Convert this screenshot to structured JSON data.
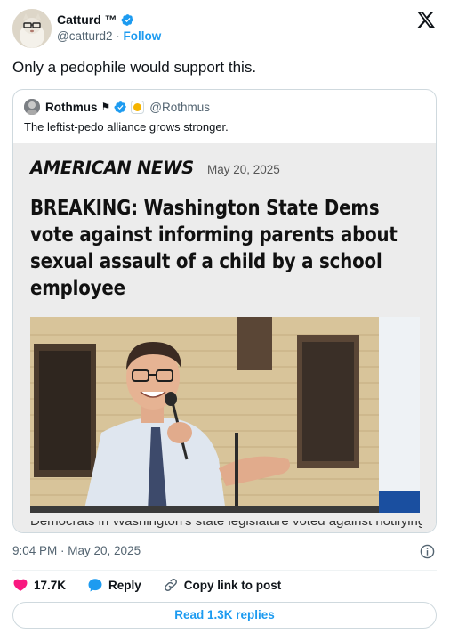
{
  "author": {
    "name": "Catturd ™",
    "handle": "@catturd2",
    "separator": "·",
    "follow_label": "Follow"
  },
  "tweet": {
    "text": "Only a pedophile would support this."
  },
  "quote": {
    "name": "Rothmus",
    "flag_glyph": "⚑",
    "handle": "@Rothmus",
    "text": "The leftist-pedo alliance grows stronger.",
    "article": {
      "brand": "AMERICAN NEWS",
      "date": "May 20, 2025",
      "headline_lines": [
        "BREAKING: Washington State Dems",
        "vote against informing parents about",
        "sexual assault of a child by a school",
        "employee"
      ],
      "cut_text": "Democrats in Washington's state legislature voted against notifying parents that"
    }
  },
  "meta": {
    "timestamp": "9:04 PM · May 20, 2025"
  },
  "actions": {
    "like_count": "17.7K",
    "reply_label": "Reply",
    "copy_label": "Copy link to post"
  },
  "read_replies_label": "Read 1.3K replies",
  "colors": {
    "brand_blue": "#1d9bf0",
    "like_pink": "#f91880",
    "muted": "#536471"
  },
  "icons": [
    "verified-icon",
    "x-logo-icon",
    "flag-icon",
    "badge-icon",
    "info-icon",
    "heart-icon",
    "reply-icon",
    "link-icon"
  ]
}
